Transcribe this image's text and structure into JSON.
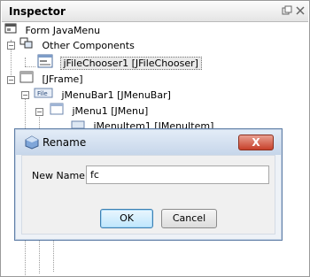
{
  "panel": {
    "title": "Inspector"
  },
  "tree": {
    "form": "Form JavaMenu",
    "other_components": "Other Components",
    "file_chooser": "jFileChooser1 [JFileChooser]",
    "jframe": "[JFrame]",
    "menubar": "jMenuBar1 [JMenuBar]",
    "menu": "jMenu1 [JMenu]",
    "menuitem": "jMenuItem1 [JMenuItem]"
  },
  "dialog": {
    "title": "Rename",
    "close_label": "X",
    "field_label": "New Name:",
    "field_value": "fc",
    "ok_label": "OK",
    "cancel_label": "Cancel"
  }
}
